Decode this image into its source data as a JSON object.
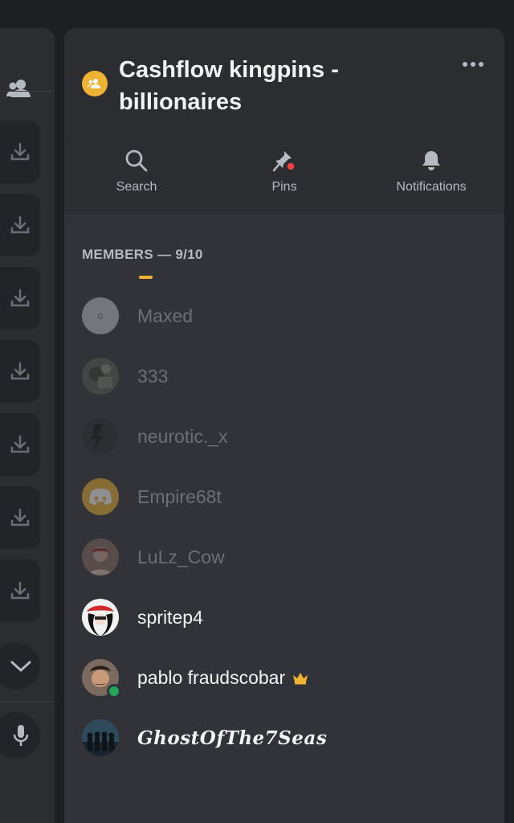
{
  "channel": {
    "title": "Cashflow kingpins - billionaires"
  },
  "actions": [
    {
      "label": "Search",
      "icon": "search-icon"
    },
    {
      "label": "Pins",
      "icon": "pin-icon"
    },
    {
      "label": "Notifications",
      "icon": "bell-icon"
    }
  ],
  "members_header": "MEMBERS — 9/10",
  "members": [
    {
      "name": "Maxed",
      "status": "offline",
      "avatar_color": "#c7c8cc"
    },
    {
      "name": "333",
      "status": "offline",
      "avatar_color": "#5a5f55"
    },
    {
      "name": "neurotic._x",
      "status": "offline",
      "avatar_color": "#2a2a2a"
    },
    {
      "name": "Empire68t",
      "status": "offline",
      "avatar_color": "#f0b232"
    },
    {
      "name": "LuLz_Cow",
      "status": "offline",
      "avatar_color": "#8a6e66"
    },
    {
      "name": "spritep4",
      "status": "online",
      "avatar_color": "#f2f2f2"
    },
    {
      "name": "pablo fraudscobar",
      "status": "online",
      "avatar_color": "#7a6a60",
      "badge": "crown-icon"
    },
    {
      "name": "GhostOfThe7Seas",
      "status": "online",
      "avatar_color": "#2f4a5c"
    }
  ],
  "colors": {
    "accent": "#f0b232",
    "online": "#23a55a",
    "pin_dot": "#f23f43"
  }
}
